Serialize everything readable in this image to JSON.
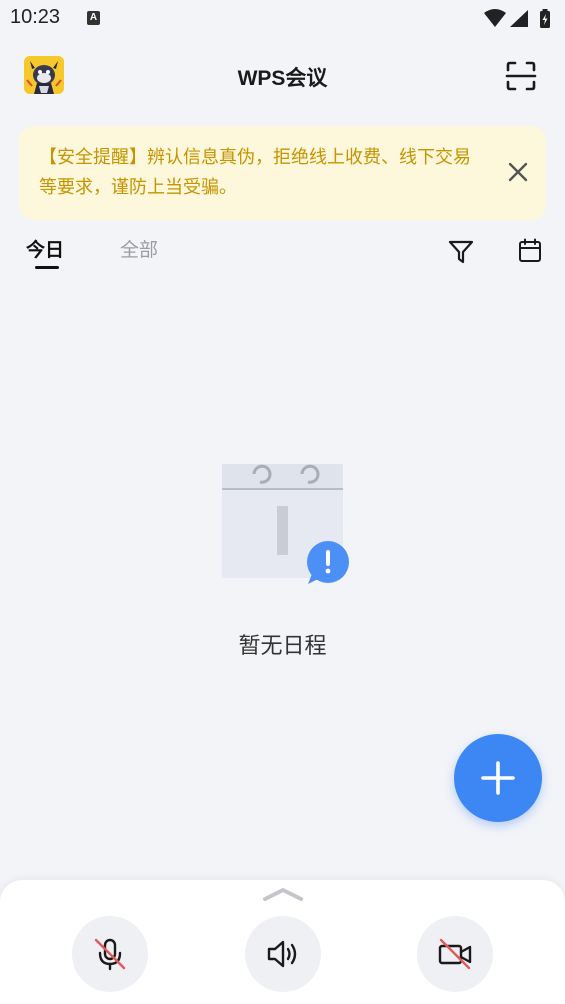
{
  "status_bar": {
    "time": "10:23",
    "notification_letter": "A"
  },
  "header": {
    "title": "WPS会议",
    "avatar": "user-avatar",
    "scan_icon": "scan-icon"
  },
  "alert": {
    "text": "【安全提醒】辨认信息真伪，拒绝线上收费、线下交易等要求，谨防上当受骗。",
    "color": "#c69400",
    "background": "#fdf7dc"
  },
  "tabs": [
    {
      "label": "今日",
      "active": true
    },
    {
      "label": "全部",
      "active": false
    }
  ],
  "toolbar": {
    "filter_icon": "filter-icon",
    "calendar_icon": "calendar-icon"
  },
  "empty_state": {
    "text": "暂无日程",
    "icon": "empty-calendar-icon"
  },
  "fab": {
    "icon": "plus-icon",
    "color": "#3d87f5"
  },
  "controls": [
    {
      "icon": "mic-muted-icon"
    },
    {
      "icon": "speaker-icon"
    },
    {
      "icon": "camera-off-icon"
    }
  ]
}
